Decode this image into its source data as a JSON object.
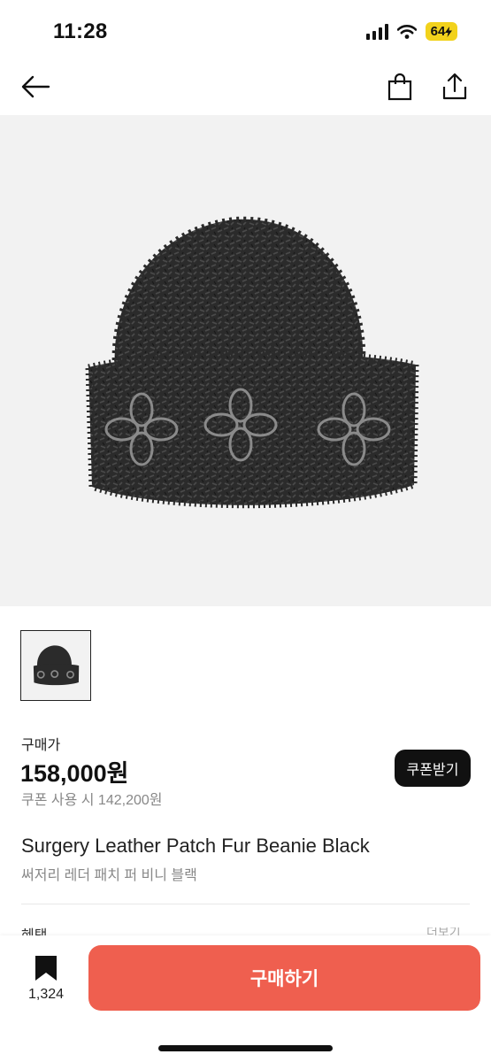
{
  "status_bar": {
    "time": "11:28",
    "battery": "64",
    "icons": [
      "cellular-signal-icon",
      "wifi-icon",
      "battery-charging-icon"
    ]
  },
  "nav": {
    "icons": [
      "back-arrow-icon",
      "shopping-bag-icon",
      "share-icon"
    ]
  },
  "product": {
    "image": "fur-beanie-black",
    "thumbnail_count": 1,
    "price_label": "구매가",
    "price": "158,000원",
    "coupon_price": "쿠폰 사용 시 142,200원",
    "coupon_button": "쿠폰받기",
    "name": "Surgery Leather Patch Fur Beanie Black",
    "name_kr": "써저리 레더 패치 퍼 비니 블랙",
    "partial_left": "혜택",
    "partial_right": "더보기"
  },
  "bottom_bar": {
    "bookmark_count": "1,324",
    "buy_button": "구매하기",
    "accent_color": "#ef5f4f"
  }
}
